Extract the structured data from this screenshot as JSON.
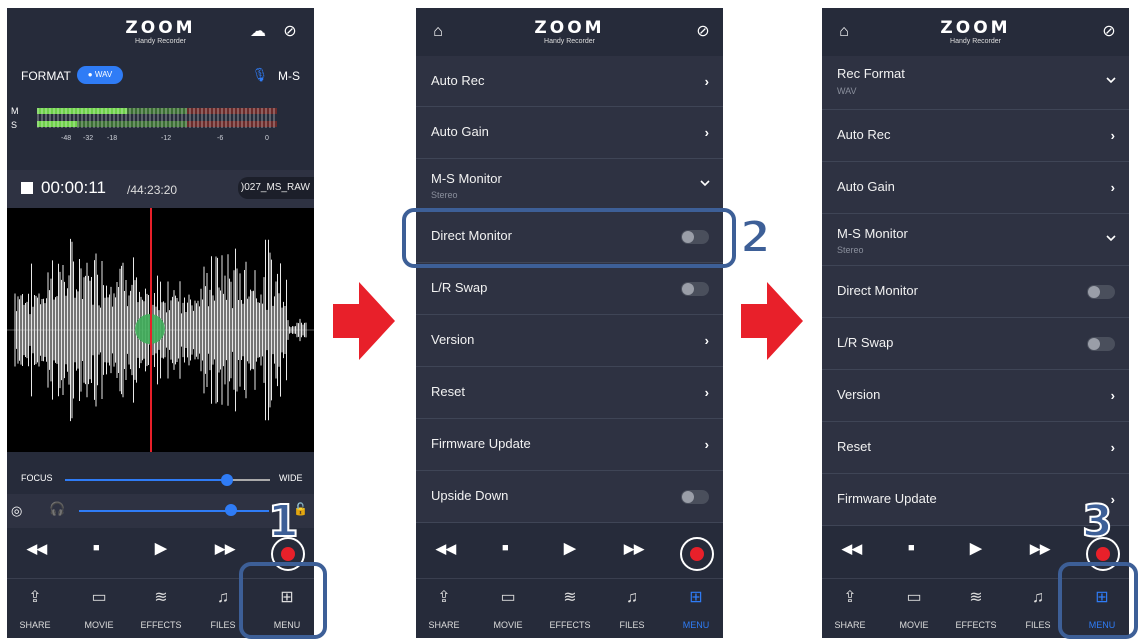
{
  "app": {
    "logo": "ZOOM",
    "logo_subtitle": "Handy Recorder"
  },
  "screen1": {
    "format_label": "FORMAT",
    "format_value": "WAV",
    "channel_mode": "M-S",
    "meter_channels": [
      "M",
      "S"
    ],
    "meter_scale": [
      "-48",
      "-32",
      "-18",
      "-12",
      "-6",
      "0"
    ],
    "elapsed_time": "00:00:11",
    "total_time": "/44:23:20",
    "file_name": ")027_MS_RAW",
    "focus_label": "FOCUS",
    "wide_label": "WIDE",
    "step_number": "1"
  },
  "screen2": {
    "menu_items": [
      {
        "label": "Auto Rec",
        "control": "chevron"
      },
      {
        "label": "Auto Gain",
        "control": "chevron"
      },
      {
        "label": "M-S Monitor",
        "sub": "Stereo",
        "control": "dropdown"
      },
      {
        "label": "Direct Monitor",
        "control": "toggle-off"
      },
      {
        "label": "L/R Swap",
        "control": "toggle-off"
      },
      {
        "label": "Version",
        "control": "chevron"
      },
      {
        "label": "Reset",
        "control": "chevron"
      },
      {
        "label": "Firmware Update",
        "control": "chevron"
      },
      {
        "label": "Upside Down",
        "control": "toggle-off"
      }
    ],
    "step_number": "2"
  },
  "screen3": {
    "menu_items": [
      {
        "label": "Rec Format",
        "sub": "WAV",
        "control": "dropdown"
      },
      {
        "label": "Auto Rec",
        "control": "chevron"
      },
      {
        "label": "Auto Gain",
        "control": "chevron"
      },
      {
        "label": "M-S Monitor",
        "sub": "Stereo",
        "control": "dropdown"
      },
      {
        "label": "Direct Monitor",
        "control": "toggle-off"
      },
      {
        "label": "L/R Swap",
        "control": "toggle-off"
      },
      {
        "label": "Version",
        "control": "chevron"
      },
      {
        "label": "Reset",
        "control": "chevron"
      },
      {
        "label": "Firmware Update",
        "control": "chevron"
      }
    ],
    "step_number": "3"
  },
  "tabs": [
    {
      "label": "SHARE",
      "icon": "share-icon"
    },
    {
      "label": "MOVIE",
      "icon": "movie-icon"
    },
    {
      "label": "EFFECTS",
      "icon": "effects-icon"
    },
    {
      "label": "FILES",
      "icon": "files-icon"
    },
    {
      "label": "MENU",
      "icon": "menu-grid-icon"
    }
  ],
  "colors": {
    "accent": "#2f7cf6",
    "highlight": "#3d5f97",
    "arrow": "#e8202a",
    "record": "#e8202a"
  }
}
